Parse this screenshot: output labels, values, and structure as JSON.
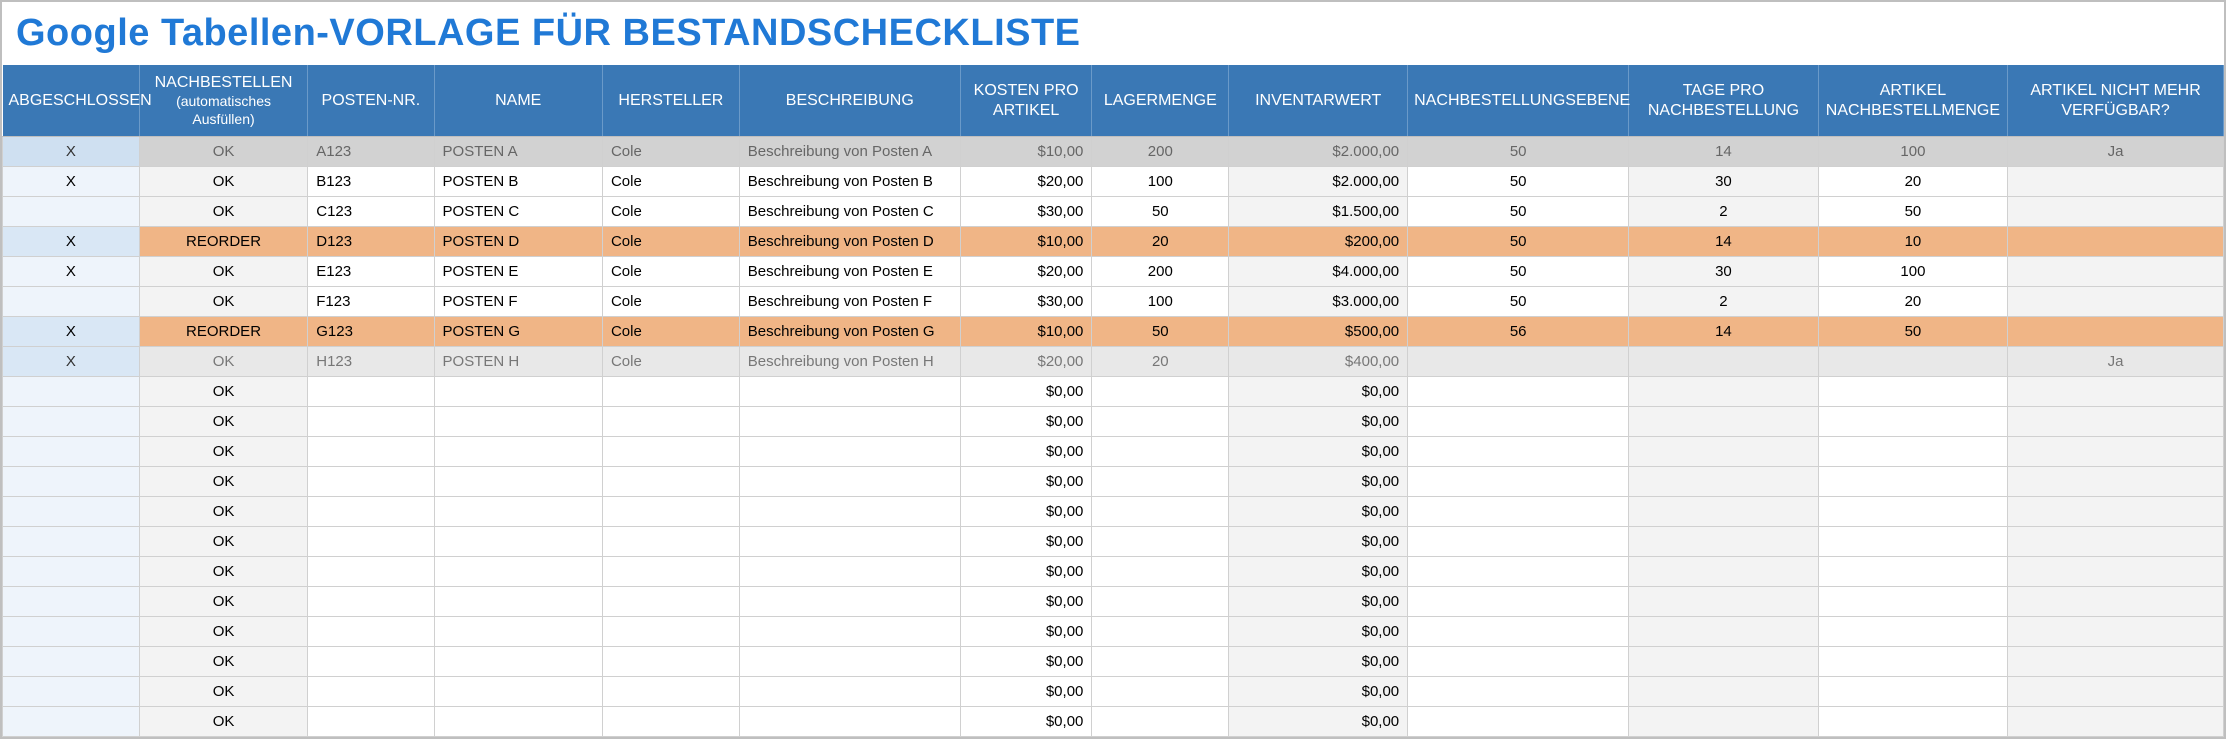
{
  "title": "Google Tabellen-VORLAGE FÜR BESTANDSCHECKLISTE",
  "headers": {
    "done": "ABGESCHLOSSEN",
    "reorder": "NACHBESTELLEN",
    "reorder_sub": "(automatisches Ausfüllen)",
    "item_no": "POSTEN-NR.",
    "name": "NAME",
    "mfr": "HERSTELLER",
    "desc": "BESCHREIBUNG",
    "cost": "KOSTEN PRO ARTIKEL",
    "stock": "LAGERMENGE",
    "inv": "INVENTARWERT",
    "reolvl": "NACHBESTELLUNGSEBENE",
    "days": "TAGE PRO NACHBESTELLUNG",
    "reoqty": "ARTIKEL NACHBESTELLMENGE",
    "disc": "ARTIKEL NICHT MEHR VERFÜGBAR?"
  },
  "rows": [
    {
      "state": "grey",
      "done": "X",
      "reorder": "OK",
      "item_no": "A123",
      "name": "POSTEN A",
      "mfr": "Cole",
      "desc": "Beschreibung von Posten A",
      "cost": "$10,00",
      "stock": "200",
      "inv": "$2.000,00",
      "reolvl": "50",
      "days": "14",
      "reoqty": "100",
      "disc": "Ja"
    },
    {
      "state": "normal",
      "done": "X",
      "reorder": "OK",
      "item_no": "B123",
      "name": "POSTEN B",
      "mfr": "Cole",
      "desc": "Beschreibung von Posten B",
      "cost": "$20,00",
      "stock": "100",
      "inv": "$2.000,00",
      "reolvl": "50",
      "days": "30",
      "reoqty": "20",
      "disc": ""
    },
    {
      "state": "normal",
      "done": "",
      "reorder": "OK",
      "item_no": "C123",
      "name": "POSTEN C",
      "mfr": "Cole",
      "desc": "Beschreibung von Posten C",
      "cost": "$30,00",
      "stock": "50",
      "inv": "$1.500,00",
      "reolvl": "50",
      "days": "2",
      "reoqty": "50",
      "disc": ""
    },
    {
      "state": "orange",
      "done": "X",
      "reorder": "REORDER",
      "item_no": "D123",
      "name": "POSTEN D",
      "mfr": "Cole",
      "desc": "Beschreibung von Posten D",
      "cost": "$10,00",
      "stock": "20",
      "inv": "$200,00",
      "reolvl": "50",
      "days": "14",
      "reoqty": "10",
      "disc": ""
    },
    {
      "state": "normal",
      "done": "X",
      "reorder": "OK",
      "item_no": "E123",
      "name": "POSTEN E",
      "mfr": "Cole",
      "desc": "Beschreibung von Posten E",
      "cost": "$20,00",
      "stock": "200",
      "inv": "$4.000,00",
      "reolvl": "50",
      "days": "30",
      "reoqty": "100",
      "disc": ""
    },
    {
      "state": "normal",
      "done": "",
      "reorder": "OK",
      "item_no": "F123",
      "name": "POSTEN F",
      "mfr": "Cole",
      "desc": "Beschreibung von Posten F",
      "cost": "$30,00",
      "stock": "100",
      "inv": "$3.000,00",
      "reolvl": "50",
      "days": "2",
      "reoqty": "20",
      "disc": ""
    },
    {
      "state": "orange",
      "done": "X",
      "reorder": "REORDER",
      "item_no": "G123",
      "name": "POSTEN G",
      "mfr": "Cole",
      "desc": "Beschreibung von Posten G",
      "cost": "$10,00",
      "stock": "50",
      "inv": "$500,00",
      "reolvl": "56",
      "days": "14",
      "reoqty": "50",
      "disc": ""
    },
    {
      "state": "greylt",
      "done": "X",
      "reorder": "OK",
      "item_no": "H123",
      "name": "POSTEN H",
      "mfr": "Cole",
      "desc": "Beschreibung von Posten H",
      "cost": "$20,00",
      "stock": "20",
      "inv": "$400,00",
      "reolvl": "",
      "days": "",
      "reoqty": "",
      "disc": "Ja"
    },
    {
      "state": "normal",
      "done": "",
      "reorder": "OK",
      "item_no": "",
      "name": "",
      "mfr": "",
      "desc": "",
      "cost": "$0,00",
      "stock": "",
      "inv": "$0,00",
      "reolvl": "",
      "days": "",
      "reoqty": "",
      "disc": ""
    },
    {
      "state": "normal",
      "done": "",
      "reorder": "OK",
      "item_no": "",
      "name": "",
      "mfr": "",
      "desc": "",
      "cost": "$0,00",
      "stock": "",
      "inv": "$0,00",
      "reolvl": "",
      "days": "",
      "reoqty": "",
      "disc": ""
    },
    {
      "state": "normal",
      "done": "",
      "reorder": "OK",
      "item_no": "",
      "name": "",
      "mfr": "",
      "desc": "",
      "cost": "$0,00",
      "stock": "",
      "inv": "$0,00",
      "reolvl": "",
      "days": "",
      "reoqty": "",
      "disc": ""
    },
    {
      "state": "normal",
      "done": "",
      "reorder": "OK",
      "item_no": "",
      "name": "",
      "mfr": "",
      "desc": "",
      "cost": "$0,00",
      "stock": "",
      "inv": "$0,00",
      "reolvl": "",
      "days": "",
      "reoqty": "",
      "disc": ""
    },
    {
      "state": "normal",
      "done": "",
      "reorder": "OK",
      "item_no": "",
      "name": "",
      "mfr": "",
      "desc": "",
      "cost": "$0,00",
      "stock": "",
      "inv": "$0,00",
      "reolvl": "",
      "days": "",
      "reoqty": "",
      "disc": ""
    },
    {
      "state": "normal",
      "done": "",
      "reorder": "OK",
      "item_no": "",
      "name": "",
      "mfr": "",
      "desc": "",
      "cost": "$0,00",
      "stock": "",
      "inv": "$0,00",
      "reolvl": "",
      "days": "",
      "reoqty": "",
      "disc": ""
    },
    {
      "state": "normal",
      "done": "",
      "reorder": "OK",
      "item_no": "",
      "name": "",
      "mfr": "",
      "desc": "",
      "cost": "$0,00",
      "stock": "",
      "inv": "$0,00",
      "reolvl": "",
      "days": "",
      "reoqty": "",
      "disc": ""
    },
    {
      "state": "normal",
      "done": "",
      "reorder": "OK",
      "item_no": "",
      "name": "",
      "mfr": "",
      "desc": "",
      "cost": "$0,00",
      "stock": "",
      "inv": "$0,00",
      "reolvl": "",
      "days": "",
      "reoqty": "",
      "disc": ""
    },
    {
      "state": "normal",
      "done": "",
      "reorder": "OK",
      "item_no": "",
      "name": "",
      "mfr": "",
      "desc": "",
      "cost": "$0,00",
      "stock": "",
      "inv": "$0,00",
      "reolvl": "",
      "days": "",
      "reoqty": "",
      "disc": ""
    },
    {
      "state": "normal",
      "done": "",
      "reorder": "OK",
      "item_no": "",
      "name": "",
      "mfr": "",
      "desc": "",
      "cost": "$0,00",
      "stock": "",
      "inv": "$0,00",
      "reolvl": "",
      "days": "",
      "reoqty": "",
      "disc": ""
    },
    {
      "state": "normal",
      "done": "",
      "reorder": "OK",
      "item_no": "",
      "name": "",
      "mfr": "",
      "desc": "",
      "cost": "$0,00",
      "stock": "",
      "inv": "$0,00",
      "reolvl": "",
      "days": "",
      "reoqty": "",
      "disc": ""
    },
    {
      "state": "normal",
      "done": "",
      "reorder": "OK",
      "item_no": "",
      "name": "",
      "mfr": "",
      "desc": "",
      "cost": "$0,00",
      "stock": "",
      "inv": "$0,00",
      "reolvl": "",
      "days": "",
      "reoqty": "",
      "disc": ""
    }
  ]
}
